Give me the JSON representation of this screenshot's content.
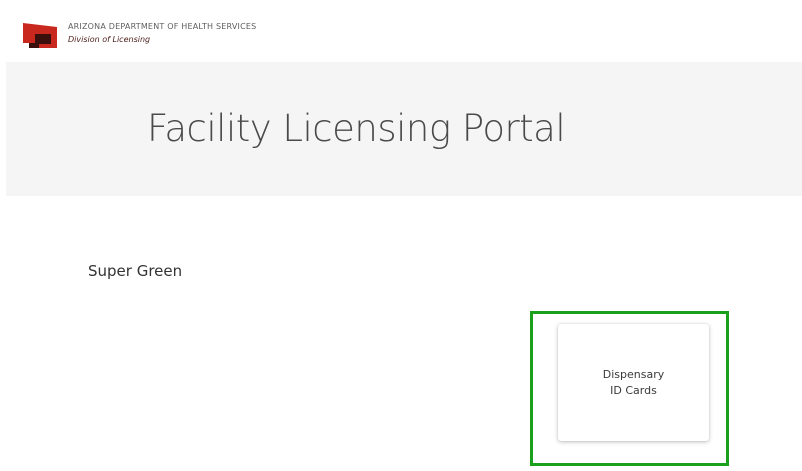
{
  "header": {
    "org_name": "ARIZONA DEPARTMENT OF HEALTH SERVICES",
    "division": "Division of Licensing",
    "logo_icon": "adhs-logo-icon",
    "logo_colors": {
      "red": "#c8281e",
      "dark": "#3a0f0c"
    }
  },
  "hero": {
    "title": "Facility Licensing Portal"
  },
  "main": {
    "facility_name": "Super Green",
    "tiles": [
      {
        "line1": "Dispensary",
        "line2": "ID Cards",
        "highlighted": true
      }
    ]
  },
  "colors": {
    "highlight": "#1aa01a",
    "hero_bg": "#f5f5f5"
  }
}
